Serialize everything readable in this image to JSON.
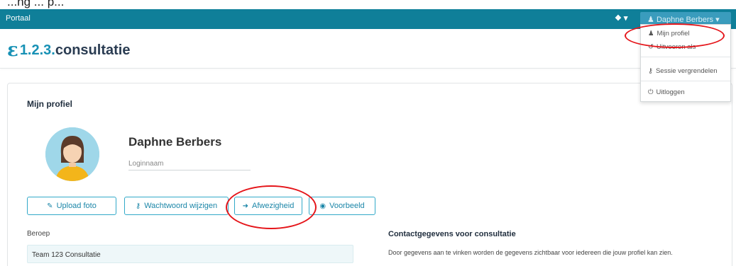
{
  "caption": "...ng ... p...",
  "topbar": {
    "brand": "Portaal",
    "info_icon": "info-icon",
    "user_name": "Daphne Berbers"
  },
  "logo": {
    "prefix": "1.2.3.",
    "word": "consultatie"
  },
  "user_menu": {
    "items": [
      {
        "icon": "user-icon",
        "glyph": "♟",
        "label": "Mijn profiel"
      },
      {
        "icon": "undo-icon",
        "glyph": "↺",
        "label": "Uitvoeren als"
      },
      {
        "icon": "key-icon",
        "glyph": "⚷",
        "label": "Sessie vergrendelen"
      },
      {
        "icon": "power-icon",
        "glyph": "⏻",
        "label": "Uitloggen"
      }
    ]
  },
  "profile": {
    "page_title": "Mijn profiel",
    "name": "Daphne Berbers",
    "login_placeholder": "Loginnaam"
  },
  "buttons": {
    "upload": "Upload foto",
    "password": "Wachtwoord wijzigen",
    "absence": "Afwezigheid",
    "preview": "Voorbeeld"
  },
  "fields": {
    "beroep_label": "Beroep",
    "beroep_value": "Team 123 Consultatie"
  },
  "contact": {
    "heading": "Contactgegevens voor consultatie",
    "text": "Door gegevens aan te vinken worden de gegevens zichtbaar voor iedereen die jouw profiel kan zien."
  },
  "colors": {
    "topbar": "#0f7f99",
    "accent": "#1b86a8",
    "annotation": "#e5151a"
  }
}
